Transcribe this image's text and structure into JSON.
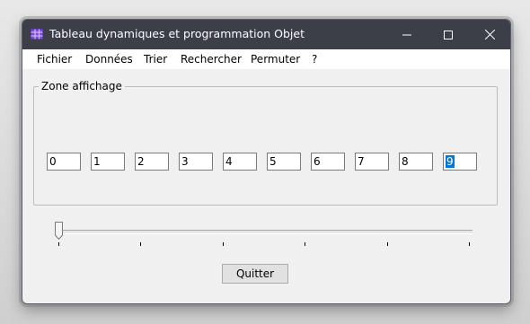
{
  "window": {
    "title": "Tableau dynamiques et programmation Objet",
    "icon": "table-icon"
  },
  "menu": {
    "items": [
      {
        "label": "Fichier",
        "name": "menu-fichier"
      },
      {
        "label": "Données",
        "name": "menu-donnees"
      },
      {
        "label": "Trier",
        "name": "menu-trier"
      },
      {
        "label": "Rechercher",
        "name": "menu-rechercher"
      },
      {
        "label": "Permuter",
        "name": "menu-permuter"
      },
      {
        "label": "?",
        "name": "menu-help"
      }
    ]
  },
  "display_zone": {
    "label": "Zone affichage",
    "values": [
      "0",
      "1",
      "2",
      "3",
      "4",
      "5",
      "6",
      "7",
      "8",
      "9"
    ],
    "selected_index": 9
  },
  "slider": {
    "value": 0,
    "tick_count": 6
  },
  "buttons": {
    "quit_label": "Quitter"
  },
  "colors": {
    "titlebar": "#3c3f48",
    "selection": "#0078d7"
  }
}
